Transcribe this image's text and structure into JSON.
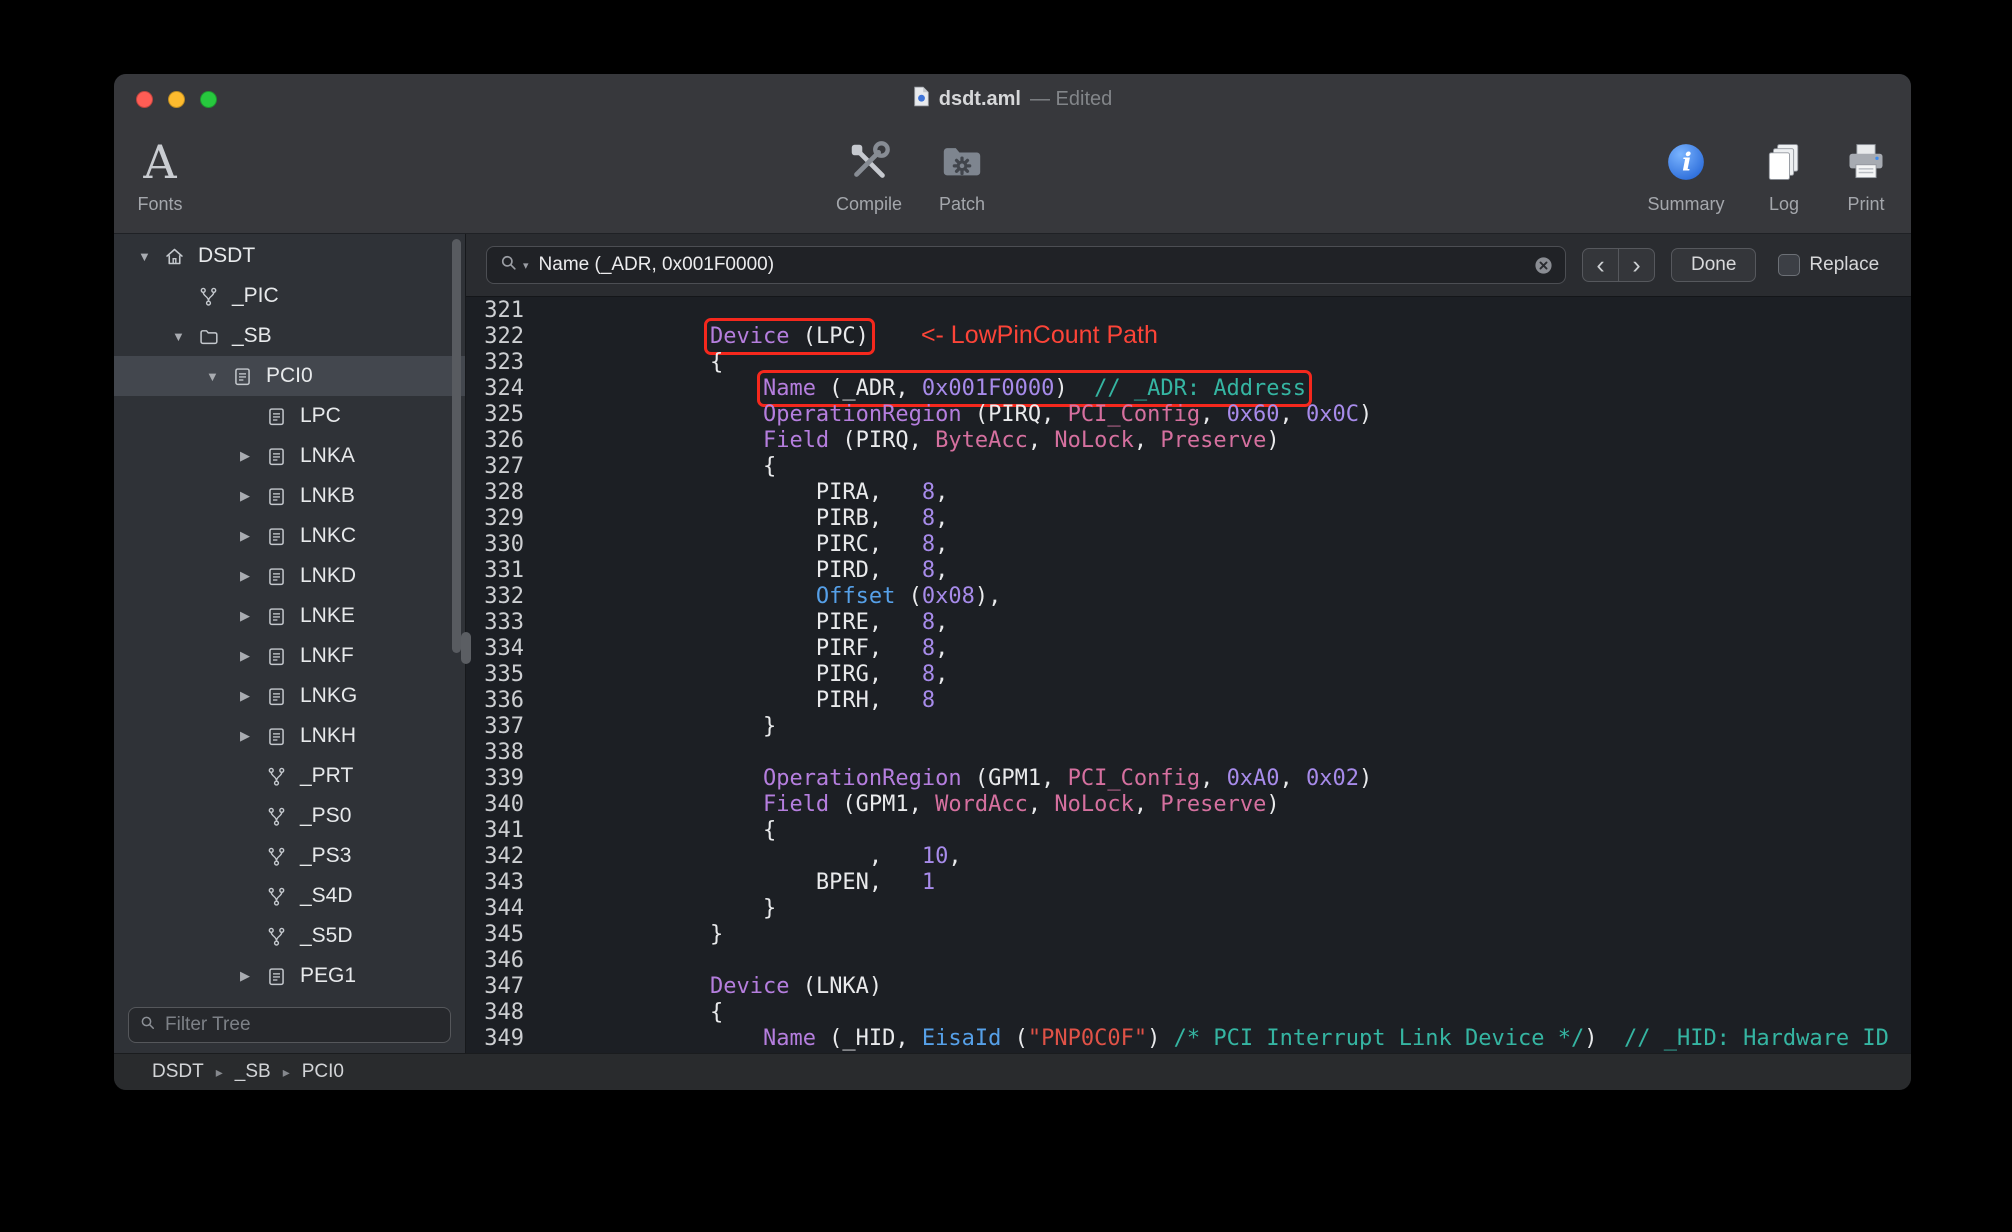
{
  "window": {
    "title_filename": "dsdt.aml",
    "title_status": "— Edited"
  },
  "toolbar": {
    "fonts": "Fonts",
    "compile": "Compile",
    "patch": "Patch",
    "summary": "Summary",
    "log": "Log",
    "print": "Print"
  },
  "search": {
    "query": "Name (_ADR, 0x001F0000)",
    "prev": "‹",
    "next": "›",
    "done": "Done",
    "replace": "Replace"
  },
  "sidebar": {
    "filter_placeholder": "Filter Tree",
    "items": [
      {
        "label": "DSDT",
        "icon": "home",
        "level": 0,
        "disclosure": "open",
        "selected": false
      },
      {
        "label": "_PIC",
        "icon": "method",
        "level": 1,
        "disclosure": "none",
        "selected": false
      },
      {
        "label": "_SB",
        "icon": "folder",
        "level": 1,
        "disclosure": "open",
        "selected": false
      },
      {
        "label": "PCI0",
        "icon": "device",
        "level": 2,
        "disclosure": "open",
        "selected": true
      },
      {
        "label": "LPC",
        "icon": "device",
        "level": 3,
        "disclosure": "none",
        "selected": false
      },
      {
        "label": "LNKA",
        "icon": "device",
        "level": 3,
        "disclosure": "closed",
        "selected": false
      },
      {
        "label": "LNKB",
        "icon": "device",
        "level": 3,
        "disclosure": "closed",
        "selected": false
      },
      {
        "label": "LNKC",
        "icon": "device",
        "level": 3,
        "disclosure": "closed",
        "selected": false
      },
      {
        "label": "LNKD",
        "icon": "device",
        "level": 3,
        "disclosure": "closed",
        "selected": false
      },
      {
        "label": "LNKE",
        "icon": "device",
        "level": 3,
        "disclosure": "closed",
        "selected": false
      },
      {
        "label": "LNKF",
        "icon": "device",
        "level": 3,
        "disclosure": "closed",
        "selected": false
      },
      {
        "label": "LNKG",
        "icon": "device",
        "level": 3,
        "disclosure": "closed",
        "selected": false
      },
      {
        "label": "LNKH",
        "icon": "device",
        "level": 3,
        "disclosure": "closed",
        "selected": false
      },
      {
        "label": "_PRT",
        "icon": "method",
        "level": 3,
        "disclosure": "none",
        "selected": false
      },
      {
        "label": "_PS0",
        "icon": "method",
        "level": 3,
        "disclosure": "none",
        "selected": false
      },
      {
        "label": "_PS3",
        "icon": "method",
        "level": 3,
        "disclosure": "none",
        "selected": false
      },
      {
        "label": "_S4D",
        "icon": "method",
        "level": 3,
        "disclosure": "none",
        "selected": false
      },
      {
        "label": "_S5D",
        "icon": "method",
        "level": 3,
        "disclosure": "none",
        "selected": false
      },
      {
        "label": "PEG1",
        "icon": "device",
        "level": 3,
        "disclosure": "closed",
        "selected": false
      }
    ]
  },
  "breadcrumb": {
    "separator": "▸",
    "items": [
      "DSDT",
      "_SB",
      "PCI0"
    ]
  },
  "colors": {
    "keyword": "#b57ede",
    "number": "#a78bea",
    "type": "#d5709f",
    "builtin": "#56a0e8",
    "string": "#e05247",
    "comment": "#35b5a2",
    "plain": "#e9eaec",
    "annotation": "#fc4438",
    "annotation_box": "#f5281d"
  },
  "annotation": {
    "lpc_note": "<- LowPinCount Path"
  },
  "editor": {
    "lines": [
      {
        "n": "321",
        "segs": []
      },
      {
        "n": "322",
        "segs": [
          {
            "t": "        "
          },
          {
            "box": [
              {
                "t": "Device",
                "c": "kw"
              },
              {
                "t": " (LPC)"
              }
            ]
          },
          {
            "t": "<- LowPinCount Path",
            "c": "annot"
          }
        ]
      },
      {
        "n": "323",
        "segs": [
          {
            "t": "        {"
          }
        ]
      },
      {
        "n": "324",
        "segs": [
          {
            "t": "            "
          },
          {
            "box": [
              {
                "t": "Name",
                "c": "kw"
              },
              {
                "t": " (_ADR, "
              },
              {
                "t": "0x001F0000",
                "c": "num"
              },
              {
                "t": ")  "
              },
              {
                "t": "// _ADR: Address",
                "c": "com"
              }
            ]
          }
        ]
      },
      {
        "n": "325",
        "segs": [
          {
            "t": "            "
          },
          {
            "t": "OperationRegion",
            "c": "kw"
          },
          {
            "t": " (PIRQ, "
          },
          {
            "t": "PCI_Config",
            "c": "type"
          },
          {
            "t": ", "
          },
          {
            "t": "0x60",
            "c": "num"
          },
          {
            "t": ", "
          },
          {
            "t": "0x0C",
            "c": "num"
          },
          {
            "t": ")"
          }
        ]
      },
      {
        "n": "326",
        "segs": [
          {
            "t": "            "
          },
          {
            "t": "Field",
            "c": "kw"
          },
          {
            "t": " (PIRQ, "
          },
          {
            "t": "ByteAcc",
            "c": "type"
          },
          {
            "t": ", "
          },
          {
            "t": "NoLock",
            "c": "type"
          },
          {
            "t": ", "
          },
          {
            "t": "Preserve",
            "c": "type"
          },
          {
            "t": ")"
          }
        ]
      },
      {
        "n": "327",
        "segs": [
          {
            "t": "            {"
          }
        ]
      },
      {
        "n": "328",
        "segs": [
          {
            "t": "                PIRA,   "
          },
          {
            "t": "8",
            "c": "num"
          },
          {
            "t": ","
          }
        ]
      },
      {
        "n": "329",
        "segs": [
          {
            "t": "                PIRB,   "
          },
          {
            "t": "8",
            "c": "num"
          },
          {
            "t": ","
          }
        ]
      },
      {
        "n": "330",
        "segs": [
          {
            "t": "                PIRC,   "
          },
          {
            "t": "8",
            "c": "num"
          },
          {
            "t": ","
          }
        ]
      },
      {
        "n": "331",
        "segs": [
          {
            "t": "                PIRD,   "
          },
          {
            "t": "8",
            "c": "num"
          },
          {
            "t": ","
          }
        ]
      },
      {
        "n": "332",
        "segs": [
          {
            "t": "                "
          },
          {
            "t": "Offset",
            "c": "fn"
          },
          {
            "t": " ("
          },
          {
            "t": "0x08",
            "c": "num"
          },
          {
            "t": "),"
          }
        ]
      },
      {
        "n": "333",
        "segs": [
          {
            "t": "                PIRE,   "
          },
          {
            "t": "8",
            "c": "num"
          },
          {
            "t": ","
          }
        ]
      },
      {
        "n": "334",
        "segs": [
          {
            "t": "                PIRF,   "
          },
          {
            "t": "8",
            "c": "num"
          },
          {
            "t": ","
          }
        ]
      },
      {
        "n": "335",
        "segs": [
          {
            "t": "                PIRG,   "
          },
          {
            "t": "8",
            "c": "num"
          },
          {
            "t": ","
          }
        ]
      },
      {
        "n": "336",
        "segs": [
          {
            "t": "                PIRH,   "
          },
          {
            "t": "8",
            "c": "num"
          }
        ]
      },
      {
        "n": "337",
        "segs": [
          {
            "t": "            }"
          }
        ]
      },
      {
        "n": "338",
        "segs": []
      },
      {
        "n": "339",
        "segs": [
          {
            "t": "            "
          },
          {
            "t": "OperationRegion",
            "c": "kw"
          },
          {
            "t": " (GPM1, "
          },
          {
            "t": "PCI_Config",
            "c": "type"
          },
          {
            "t": ", "
          },
          {
            "t": "0xA0",
            "c": "num"
          },
          {
            "t": ", "
          },
          {
            "t": "0x02",
            "c": "num"
          },
          {
            "t": ")"
          }
        ]
      },
      {
        "n": "340",
        "segs": [
          {
            "t": "            "
          },
          {
            "t": "Field",
            "c": "kw"
          },
          {
            "t": " (GPM1, "
          },
          {
            "t": "WordAcc",
            "c": "type"
          },
          {
            "t": ", "
          },
          {
            "t": "NoLock",
            "c": "type"
          },
          {
            "t": ", "
          },
          {
            "t": "Preserve",
            "c": "type"
          },
          {
            "t": ")"
          }
        ]
      },
      {
        "n": "341",
        "segs": [
          {
            "t": "            {"
          }
        ]
      },
      {
        "n": "342",
        "segs": [
          {
            "t": "                    ,   "
          },
          {
            "t": "10",
            "c": "num"
          },
          {
            "t": ","
          }
        ]
      },
      {
        "n": "343",
        "segs": [
          {
            "t": "                BPEN,   "
          },
          {
            "t": "1",
            "c": "num"
          }
        ]
      },
      {
        "n": "344",
        "segs": [
          {
            "t": "            }"
          }
        ]
      },
      {
        "n": "345",
        "segs": [
          {
            "t": "        }"
          }
        ]
      },
      {
        "n": "346",
        "segs": []
      },
      {
        "n": "347",
        "segs": [
          {
            "t": "        "
          },
          {
            "t": "Device",
            "c": "kw"
          },
          {
            "t": " (LNKA)"
          }
        ]
      },
      {
        "n": "348",
        "segs": [
          {
            "t": "        {"
          }
        ]
      },
      {
        "n": "349",
        "segs": [
          {
            "t": "            "
          },
          {
            "t": "Name",
            "c": "kw"
          },
          {
            "t": " (_HID, "
          },
          {
            "t": "EisaId",
            "c": "fn"
          },
          {
            "t": " ("
          },
          {
            "t": "\"PNP0C0F\"",
            "c": "str"
          },
          {
            "t": ") "
          },
          {
            "t": "/* PCI Interrupt Link Device */",
            "c": "com"
          },
          {
            "t": ")  "
          },
          {
            "t": "// _HID: Hardware ID",
            "c": "com"
          }
        ]
      }
    ]
  }
}
